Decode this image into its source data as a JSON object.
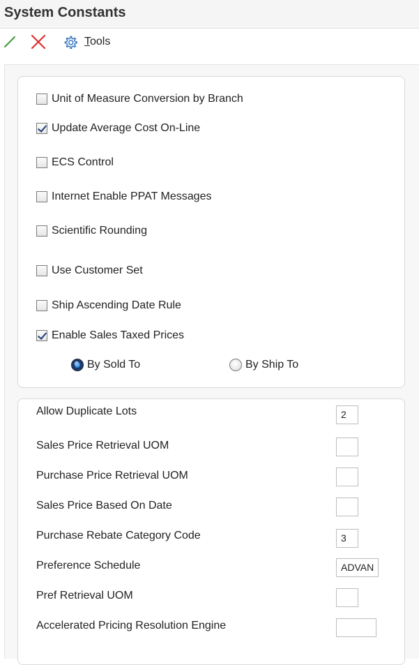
{
  "window": {
    "title": "System Constants"
  },
  "toolbar": {
    "ok_icon": "checkmark-icon",
    "cancel_icon": "close-icon",
    "tools_icon": "gear-icon",
    "tools_prefix": "T",
    "tools_rest": "ools",
    "colors": {
      "ok": "#3c9a3c",
      "cancel": "#e03030",
      "tools": "#2a6ebb"
    }
  },
  "options": {
    "checkboxes": [
      {
        "label": "Unit of Measure Conversion by Branch",
        "checked": false
      },
      {
        "label": "Update Average Cost On-Line",
        "checked": true
      },
      {
        "label": "ECS Control",
        "checked": false
      },
      {
        "label": "Internet Enable PPAT Messages",
        "checked": false
      },
      {
        "label": "Scientific Rounding",
        "checked": false
      },
      {
        "label": "Use Customer Set",
        "checked": false
      },
      {
        "label": "Ship Ascending Date Rule",
        "checked": false
      },
      {
        "label": "Enable Sales Taxed Prices",
        "checked": true
      }
    ],
    "radios": [
      {
        "label": "By Sold To",
        "selected": true
      },
      {
        "label": "By Ship To",
        "selected": false
      }
    ]
  },
  "fields": [
    {
      "label": "Allow Duplicate Lots",
      "value": "2"
    },
    {
      "label": "Sales Price Retrieval UOM",
      "value": ""
    },
    {
      "label": "Purchase Price Retrieval UOM",
      "value": ""
    },
    {
      "label": "Sales Price Based On Date",
      "value": ""
    },
    {
      "label": "Purchase Rebate Category Code",
      "value": "3"
    },
    {
      "label": "Preference Schedule",
      "value": "ADVAN"
    },
    {
      "label": "Pref Retrieval UOM",
      "value": ""
    },
    {
      "label": "Accelerated Pricing Resolution Engine",
      "value": ""
    }
  ]
}
